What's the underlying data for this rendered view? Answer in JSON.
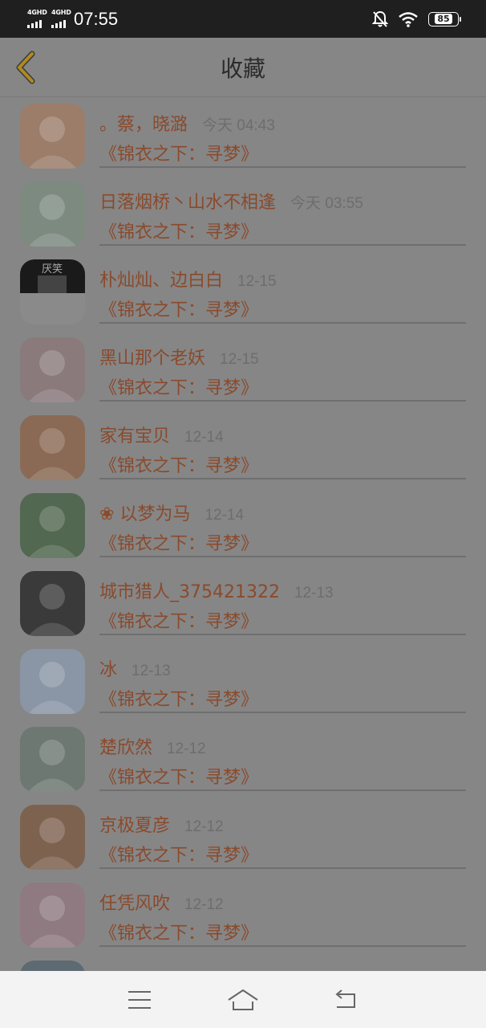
{
  "status_bar": {
    "network_1": "4GHD",
    "network_2": "4GHD",
    "time": "07:55",
    "battery": "85"
  },
  "header": {
    "title": "收藏"
  },
  "favorites": [
    {
      "name": "。蔡，晓潞",
      "date": "今天 04:43",
      "book": "《锦衣之下：寻梦》",
      "avatar_color": "#9b7d6a"
    },
    {
      "name": "日落烟桥丶山水不相逢",
      "date": "今天 03:55",
      "book": "《锦衣之下：寻梦》",
      "avatar_color": "#7d8a80"
    },
    {
      "name": "朴灿灿、边白白",
      "date": "12-15",
      "book": "《锦衣之下：寻梦》",
      "avatar_color": "#2a2a2a",
      "avatar_label": "厌笑"
    },
    {
      "name": "黑山那个老妖",
      "date": "12-15",
      "book": "《锦衣之下：寻梦》",
      "avatar_color": "#8a7a7c"
    },
    {
      "name": "家有宝贝",
      "date": "12-14",
      "book": "《锦衣之下：寻梦》",
      "avatar_color": "#8a6a55"
    },
    {
      "name": "❀ 以梦为马",
      "date": "12-14",
      "book": "《锦衣之下：寻梦》",
      "avatar_color": "#526850"
    },
    {
      "name": "城市猎人_375421322",
      "date": "12-13",
      "book": "《锦衣之下：寻梦》",
      "avatar_color": "#3a3a3a"
    },
    {
      "name": "冰",
      "date": "12-13",
      "book": "《锦衣之下：寻梦》",
      "avatar_color": "#8a96a6"
    },
    {
      "name": "楚欣然",
      "date": "12-12",
      "book": "《锦衣之下：寻梦》",
      "avatar_color": "#6e7872"
    },
    {
      "name": "京极夏彦",
      "date": "12-12",
      "book": "《锦衣之下：寻梦》",
      "avatar_color": "#7e6250"
    },
    {
      "name": "任凭风吹",
      "date": "12-12",
      "book": "《锦衣之下：寻梦》",
      "avatar_color": "#8e7a80"
    },
    {
      "name": "",
      "date": "",
      "book": "",
      "avatar_color": "#5e6a72"
    }
  ],
  "nav_bar": {
    "menu_icon": "menu-icon",
    "home_icon": "home-icon",
    "back_icon": "back-icon"
  },
  "colors": {
    "accent": "#8a4a2c",
    "back_arrow": "#b08a20"
  }
}
